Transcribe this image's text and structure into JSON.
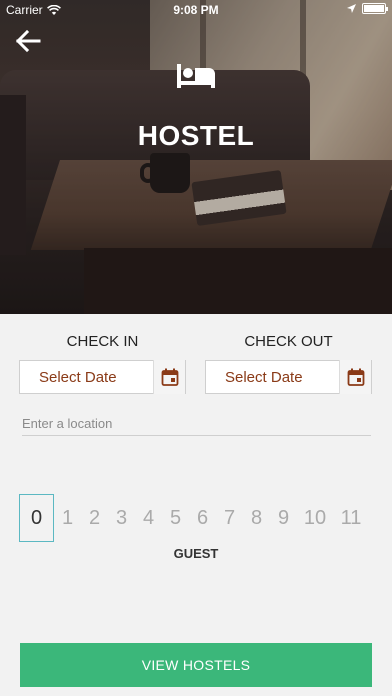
{
  "status_bar": {
    "carrier": "Carrier",
    "time": "9:08 PM"
  },
  "header": {
    "title": "HOSTEL",
    "icon": "bed-icon",
    "back_icon": "back-arrow-icon"
  },
  "form": {
    "check_in": {
      "label": "CHECK IN",
      "placeholder": "Select Date",
      "icon": "calendar-icon"
    },
    "check_out": {
      "label": "CHECK OUT",
      "placeholder": "Select Date",
      "icon": "calendar-icon"
    },
    "location": {
      "placeholder": "Enter a location",
      "value": ""
    },
    "guest": {
      "label": "GUEST",
      "selected": "0",
      "options": [
        "1",
        "2",
        "3",
        "4",
        "5",
        "6",
        "7",
        "8",
        "9",
        "10",
        "11"
      ]
    }
  },
  "cta": {
    "label": "VIEW HOSTELS"
  },
  "colors": {
    "accent_green": "#3bb77a",
    "date_text": "#8a3a17",
    "picker_border": "#5bb8c2"
  }
}
